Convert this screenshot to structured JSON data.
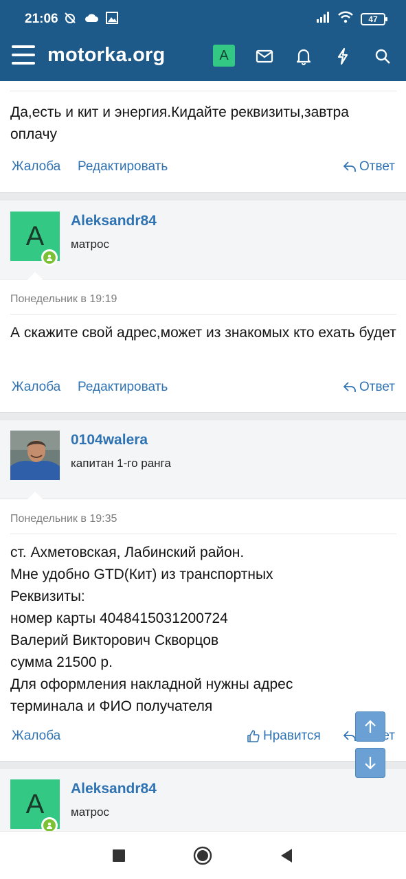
{
  "status_bar": {
    "time": "21:06",
    "battery": "47"
  },
  "header": {
    "brand": "motorka.org",
    "user_initial": "A"
  },
  "posts": [
    {
      "partial": true,
      "message": "Да,есть и кит и энергия.Кидайте реквизиты,завтра оплачу",
      "actions": {
        "report": "Жалоба",
        "edit": "Редактировать",
        "reply": "Ответ"
      }
    },
    {
      "username": "Aleksandr84",
      "user_title": "матрос",
      "avatar_initial": "A",
      "time": "Понедельник в 19:19",
      "message": "А скажите свой адрес,может из знакомых кто ехать будет",
      "actions": {
        "report": "Жалоба",
        "edit": "Редактировать",
        "reply": "Ответ"
      }
    },
    {
      "username": "0104walera",
      "user_title": "капитан 1-го ранга",
      "time": "Понедельник в 19:35",
      "message_lines": [
        "ст. Ахметовская, Лабинский район.",
        "Мне удобно GTD(Кит) из транспортных",
        "Реквизиты:",
        "номер карты 4048415031200724",
        "Валерий Викторович Скворцов",
        "сумма 21500 р.",
        "Для оформления накладной нужны адрес",
        "терминала и ФИО получателя"
      ],
      "actions": {
        "report": "Жалоба",
        "like": "Нравится",
        "reply": "Ответ"
      }
    },
    {
      "username": "Aleksandr84",
      "user_title": "матрос",
      "avatar_initial": "A"
    }
  ],
  "colors": {
    "header_bg": "#1d5a8a",
    "link": "#2f73b3",
    "avatar_green": "#33c984",
    "online_green": "#7cc133"
  },
  "icons": {
    "nav": [
      "envelope-icon",
      "bell-icon",
      "lightning-icon",
      "search-icon"
    ],
    "scroll": [
      "arrow-up-icon",
      "arrow-down-icon"
    ],
    "system": [
      "recents-icon",
      "home-icon",
      "back-icon"
    ]
  }
}
